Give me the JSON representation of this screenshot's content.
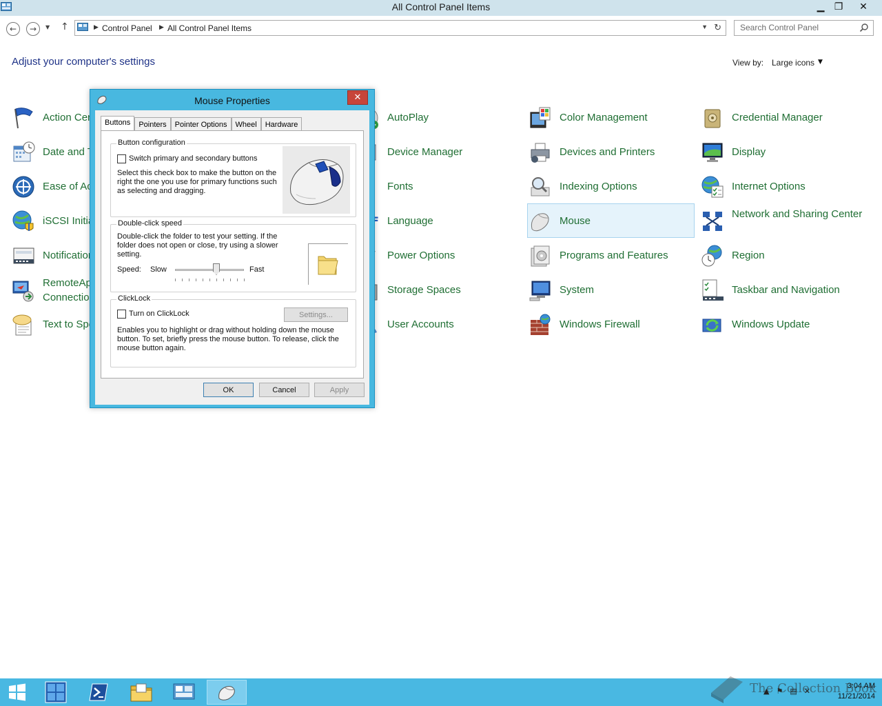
{
  "window": {
    "title": "All Control Panel Items",
    "buttons": {
      "minimize": "▁",
      "restore": "❐",
      "close": "✕"
    }
  },
  "address": {
    "crumbs": [
      "Control Panel",
      "All Control Panel Items"
    ],
    "search_placeholder": "Search Control Panel"
  },
  "content": {
    "heading": "Adjust your computer's settings",
    "view_by_label": "View by:",
    "view_by_value": "Large icons"
  },
  "items": {
    "c1": [
      {
        "label": "Action Center",
        "icon": "flag-icon"
      },
      {
        "label": "Date and Time",
        "icon": "calendar-clock-icon"
      },
      {
        "label": "Ease of Access Center",
        "icon": "ease-of-access-icon"
      },
      {
        "label": "iSCSI Initiator",
        "icon": "globe-shield-icon"
      },
      {
        "label": "Notification Area Icons",
        "icon": "notification-icon"
      },
      {
        "label": "RemoteApp and Desktop Connections",
        "icon": "remoteapp-icon"
      },
      {
        "label": "Text to Speech",
        "icon": "speech-bubble-icon"
      }
    ],
    "c2": [
      {
        "label": "AutoPlay",
        "icon": "autoplay-icon"
      },
      {
        "label": "Device Manager",
        "icon": "device-manager-icon"
      },
      {
        "label": "Fonts",
        "icon": "fonts-icon"
      },
      {
        "label": "Language",
        "icon": "language-icon"
      },
      {
        "label": "Power Options",
        "icon": "power-icon"
      },
      {
        "label": "Storage Spaces",
        "icon": "storage-icon"
      },
      {
        "label": "User Accounts",
        "icon": "user-icon"
      }
    ],
    "c3": [
      {
        "label": "Color Management",
        "icon": "color-management-icon"
      },
      {
        "label": "Devices and Printers",
        "icon": "printer-icon"
      },
      {
        "label": "Indexing Options",
        "icon": "indexing-icon"
      },
      {
        "label": "Mouse",
        "icon": "mouse-icon"
      },
      {
        "label": "Programs and Features",
        "icon": "programs-icon"
      },
      {
        "label": "System",
        "icon": "system-icon"
      },
      {
        "label": "Windows Firewall",
        "icon": "firewall-icon"
      }
    ],
    "c4": [
      {
        "label": "Credential Manager",
        "icon": "credential-icon"
      },
      {
        "label": "Display",
        "icon": "display-icon"
      },
      {
        "label": "Internet Options",
        "icon": "internet-options-icon"
      },
      {
        "label": "Network and Sharing Center",
        "icon": "network-icon"
      },
      {
        "label": "Region",
        "icon": "region-icon"
      },
      {
        "label": "Taskbar and Navigation",
        "icon": "taskbar-icon"
      },
      {
        "label": "Windows Update",
        "icon": "windows-update-icon"
      }
    ]
  },
  "dialog": {
    "title": "Mouse Properties",
    "close": "✕",
    "tabs": [
      "Buttons",
      "Pointers",
      "Pointer Options",
      "Wheel",
      "Hardware"
    ],
    "button_config": {
      "label": "Button configuration",
      "checkbox": "Switch primary and secondary buttons",
      "checked": false,
      "desc": "Select this check box to make the button on the right the one you use for primary functions such as selecting and dragging."
    },
    "double_click": {
      "label": "Double-click speed",
      "desc": "Double-click the folder to test your setting. If the folder does not open or close, try using a slower setting.",
      "speed_label": "Speed:",
      "slow": "Slow",
      "fast": "Fast",
      "speed_fraction": 0.6
    },
    "clicklock": {
      "label": "ClickLock",
      "checkbox": "Turn on ClickLock",
      "checked": false,
      "settings_button": "Settings...",
      "desc": "Enables you to highlight or drag without holding down the mouse button. To set, briefly press the mouse button. To release, click the mouse button again."
    },
    "buttons": {
      "ok": "OK",
      "cancel": "Cancel",
      "apply": "Apply"
    }
  },
  "taskbar": {
    "time": "3:04 AM",
    "date": "11/21/2014",
    "watermark": "The Collection Book"
  },
  "colors": {
    "accent": "#49b8e2",
    "link_green": "#1f6e33",
    "heading_blue": "#1e3287",
    "close_red": "#c7453a"
  }
}
